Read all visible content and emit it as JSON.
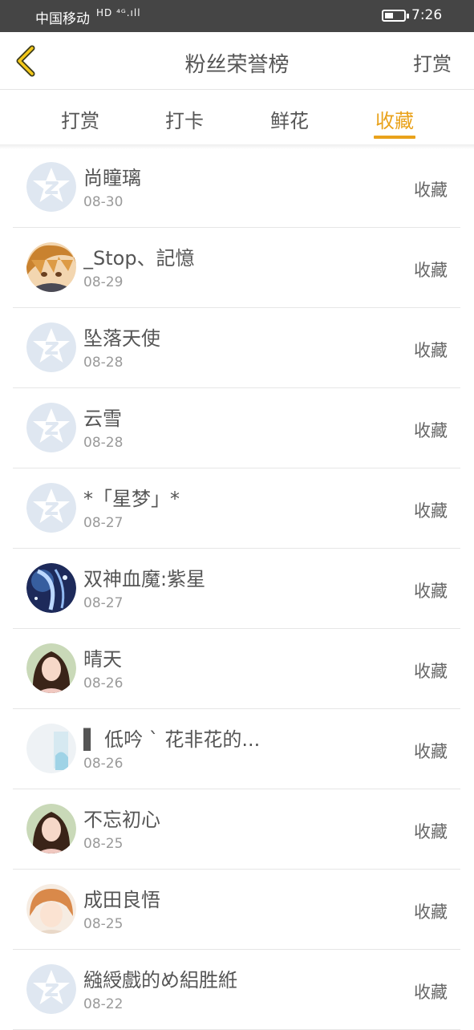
{
  "status_bar": {
    "carrier": "中国移动",
    "signal": "HD ⁴ᴳ.ıll",
    "time": "7:26"
  },
  "header": {
    "title": "粉丝荣誉榜",
    "action_label": "打赏"
  },
  "tabs": [
    {
      "label": "打赏",
      "active": false
    },
    {
      "label": "打卡",
      "active": false
    },
    {
      "label": "鲜花",
      "active": false
    },
    {
      "label": "收藏",
      "active": true
    }
  ],
  "accent_color": "#e9a21b",
  "list": [
    {
      "name": "尚瞳璃",
      "date": "08-30",
      "tag": "收藏",
      "avatar": "default-avatar-icon"
    },
    {
      "name": "_Stop、記憶",
      "date": "08-29",
      "tag": "收藏",
      "avatar": "anime-boy-avatar"
    },
    {
      "name": "坠落天使",
      "date": "08-28",
      "tag": "收藏",
      "avatar": "default-avatar-icon"
    },
    {
      "name": "云雪",
      "date": "08-28",
      "tag": "收藏",
      "avatar": "default-avatar-icon"
    },
    {
      "name": "*「星梦」*",
      "date": "08-27",
      "tag": "收藏",
      "avatar": "default-avatar-icon"
    },
    {
      "name": "双神血魔:紫星",
      "date": "08-27",
      "tag": "收藏",
      "avatar": "blue-fantasy-avatar"
    },
    {
      "name": "晴天",
      "date": "08-26",
      "tag": "收藏",
      "avatar": "girl-photo-avatar"
    },
    {
      "name": "▌ 低吟 ˋ 花非花的...",
      "date": "08-26",
      "tag": "收藏",
      "avatar": "light-blue-avatar"
    },
    {
      "name": "不忘初心",
      "date": "08-25",
      "tag": "收藏",
      "avatar": "girl-photo-avatar"
    },
    {
      "name": "成田良悟",
      "date": "08-25",
      "tag": "收藏",
      "avatar": "anime-girl-avatar"
    },
    {
      "name": "繈綬戲的め絽胜絍",
      "date": "08-22",
      "tag": "收藏",
      "avatar": "default-avatar-icon"
    }
  ]
}
